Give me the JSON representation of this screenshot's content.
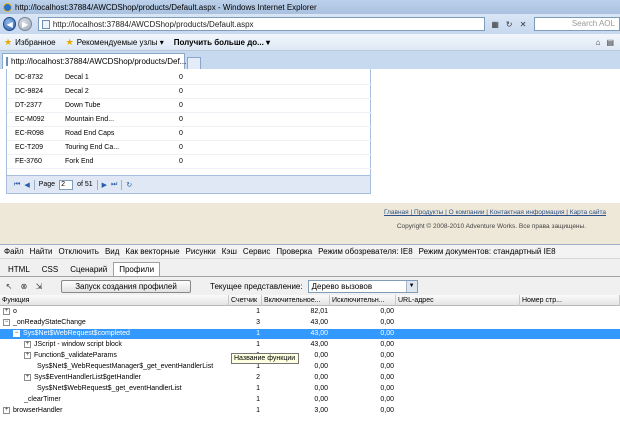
{
  "window": {
    "title": "http://localhost:37884/AWCDShop/products/Default.aspx - Windows Internet Explorer"
  },
  "address_bar": {
    "url": "http://localhost:37884/AWCDShop/products/Default.aspx",
    "search_placeholder": "Search AOL"
  },
  "favorites_bar": {
    "favorites_label": "Избранное",
    "suggested_sites": "Рекомендуемые узлы ▾",
    "get_more": "Получить больше до... ▾"
  },
  "tab": {
    "title": "http://localhost:37884/AWCDShop/products/Def..."
  },
  "product_grid": {
    "rows": [
      {
        "code": "DC-8732",
        "name": "Decal 1",
        "qty": "0"
      },
      {
        "code": "DC-9824",
        "name": "Decal 2",
        "qty": "0"
      },
      {
        "code": "DT-2377",
        "name": "Down Tube",
        "qty": "0"
      },
      {
        "code": "EC-M092",
        "name": "Mountain End...",
        "qty": "0"
      },
      {
        "code": "EC-R098",
        "name": "Road End Caps",
        "qty": "0"
      },
      {
        "code": "EC-T209",
        "name": "Touring End Ca...",
        "qty": "0"
      },
      {
        "code": "FE-3760",
        "name": "Fork End",
        "qty": "0"
      }
    ],
    "pager": {
      "page_label": "Page",
      "page_value": "2",
      "of_label": "of 51"
    }
  },
  "footer": {
    "links": "Главная | Продукты | О компании | Контактная информация | Карта сайта",
    "copyright": "Copyright © 2008-2010 Adventure Works. Все права защищены."
  },
  "devtools": {
    "menu": [
      "Файл",
      "Найти",
      "Отключить",
      "Вид",
      "Как векторные",
      "Рисунки",
      "Кэш",
      "Сервис",
      "Проверка",
      "Режим обозревателя: IE8",
      "Режим документов: стандартный IE8"
    ],
    "tabs": [
      "HTML",
      "CSS",
      "Сценарий",
      "Профили"
    ],
    "active_tab": "Профили",
    "start_profiling_label": "Запуск создания профилей",
    "current_view_label": "Текущее представление:",
    "current_view_value": "Дерево вызовов",
    "columns": [
      "Функция",
      "Счетчик",
      "Включительное...",
      "Исключительн...",
      "URL-адрес",
      "Номер стр..."
    ],
    "tooltip": "Название функции",
    "rows": [
      {
        "func": "o",
        "count": "1",
        "incl": "82,01",
        "excl": "0,00",
        "expander": "+",
        "indent": 0
      },
      {
        "func": "_onReadyStateChange",
        "count": "3",
        "incl": "43,00",
        "excl": "0,00",
        "expander": "-",
        "indent": 0
      },
      {
        "func": "Sys$Net$WebRequest$completed",
        "count": "1",
        "incl": "43,00",
        "excl": "0,00",
        "expander": "-",
        "indent": 1,
        "selected": true
      },
      {
        "func": "JScript - window script block",
        "count": "1",
        "incl": "43,00",
        "excl": "0,00",
        "expander": "+",
        "indent": 2
      },
      {
        "func": "Function$_validateParams",
        "count": "1",
        "incl": "0,00",
        "excl": "0,00",
        "expander": "+",
        "indent": 2
      },
      {
        "func": "Sys$Net$_WebRequestManager$_get_eventHandlerList",
        "count": "1",
        "incl": "0,00",
        "excl": "0,00",
        "expander": "",
        "indent": 2
      },
      {
        "func": "Sys$EventHandlerList$getHandler",
        "count": "2",
        "incl": "0,00",
        "excl": "0,00",
        "expander": "+",
        "indent": 2
      },
      {
        "func": "Sys$Net$WebRequest$_get_eventHandlerList",
        "count": "1",
        "incl": "0,00",
        "excl": "0,00",
        "expander": "",
        "indent": 2
      },
      {
        "func": "_clearTimer",
        "count": "1",
        "incl": "0,00",
        "excl": "0,00",
        "expander": "",
        "indent": 1
      },
      {
        "func": "browserHandler",
        "count": "1",
        "incl": "3,00",
        "excl": "0,00",
        "expander": "+",
        "indent": 0
      }
    ]
  }
}
